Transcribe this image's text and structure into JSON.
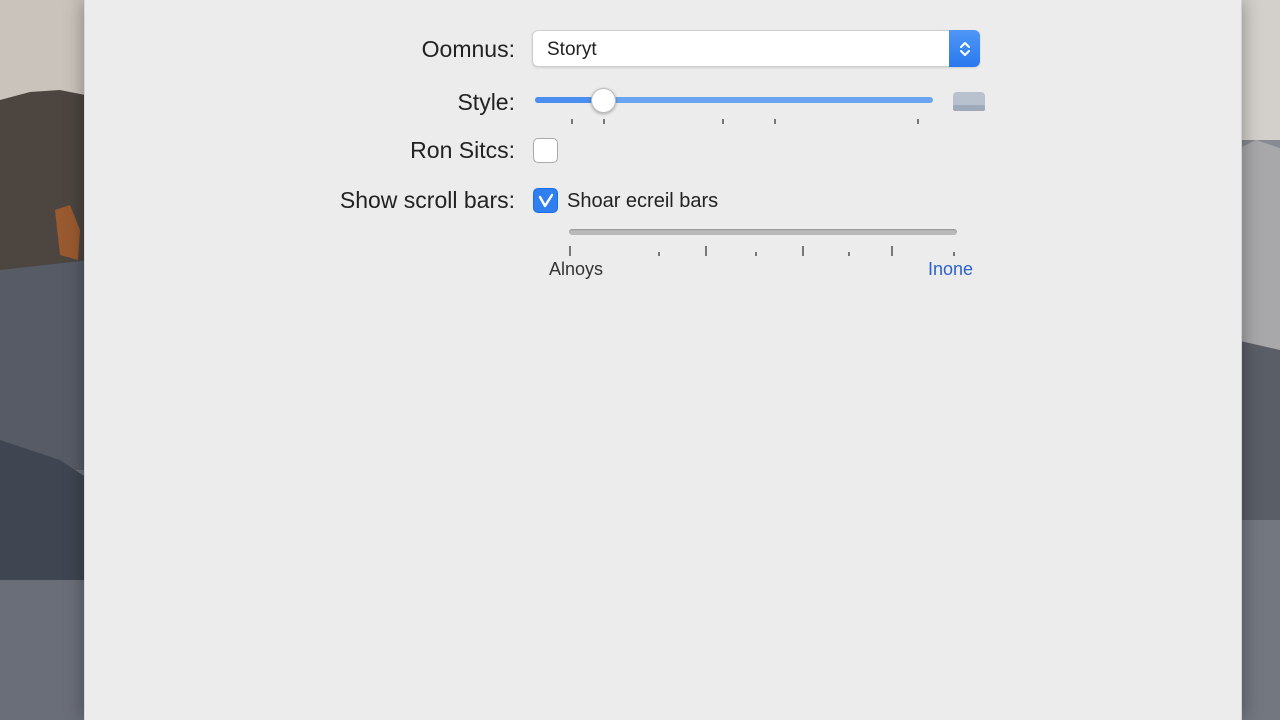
{
  "window": {
    "background": "#ececec",
    "accent": "#2f7ff0"
  },
  "fields": {
    "domains_label": "Oomnus:",
    "domains_value": "Storyt",
    "style_label": "Style:",
    "ron_sites_label": "Ron Sitcs:",
    "scroll_bars_label": "Show scroll bars:"
  },
  "style_slider": {
    "value_fraction": 0.17,
    "ticks": [
      0.09,
      0.17,
      0.47,
      0.6,
      0.96
    ]
  },
  "ron_sites_checkbox": {
    "checked": false
  },
  "scroll_bars_checkbox": {
    "checked": true,
    "label": "Shoar ecreil bars"
  },
  "scroll_scale": {
    "min_label": "Alnoys",
    "max_label": "Inone",
    "ticks": [
      0.0,
      0.23,
      0.35,
      0.48,
      0.6,
      0.72,
      0.83,
      0.99
    ]
  },
  "icons": {
    "popup_stepper": "chevron-updown-icon",
    "size": "size-icon",
    "check": "checkmark-icon"
  }
}
